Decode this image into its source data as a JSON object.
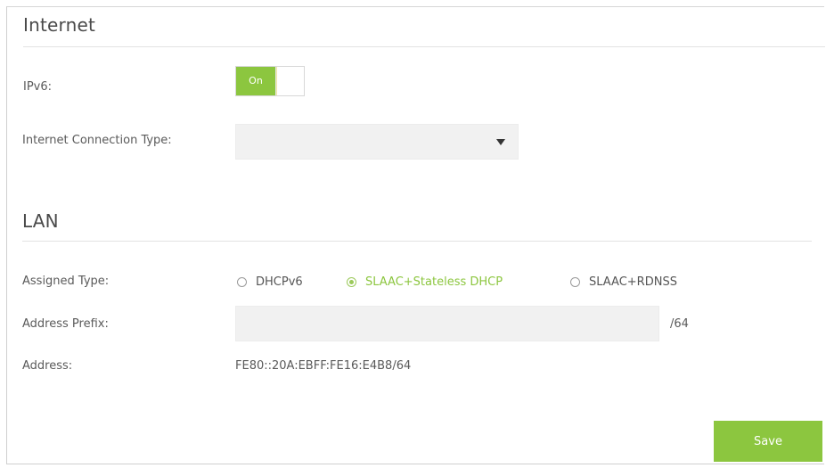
{
  "internet": {
    "title": "Internet",
    "ipv6_label": "IPv6:",
    "ipv6_toggle": {
      "state_label": "On",
      "enabled": true
    },
    "connection_type_label": "Internet Connection Type:",
    "connection_type_value": ""
  },
  "lan": {
    "title": "LAN",
    "assigned_type_label": "Assigned Type:",
    "assigned_type_options": [
      {
        "label": "DHCPv6",
        "selected": false
      },
      {
        "label": "SLAAC+Stateless DHCP",
        "selected": true
      },
      {
        "label": "SLAAC+RDNSS",
        "selected": false
      }
    ],
    "address_prefix_label": "Address Prefix:",
    "address_prefix_value": "",
    "address_prefix_suffix": "/64",
    "address_label": "Address:",
    "address_value": "FE80::20A:EBFF:FE16:E4B8/64"
  },
  "actions": {
    "save_label": "Save"
  },
  "colors": {
    "accent": "#8cc63f",
    "field_background": "#f1f1f1",
    "rule": "#e2e2e2",
    "text": "#555555"
  }
}
